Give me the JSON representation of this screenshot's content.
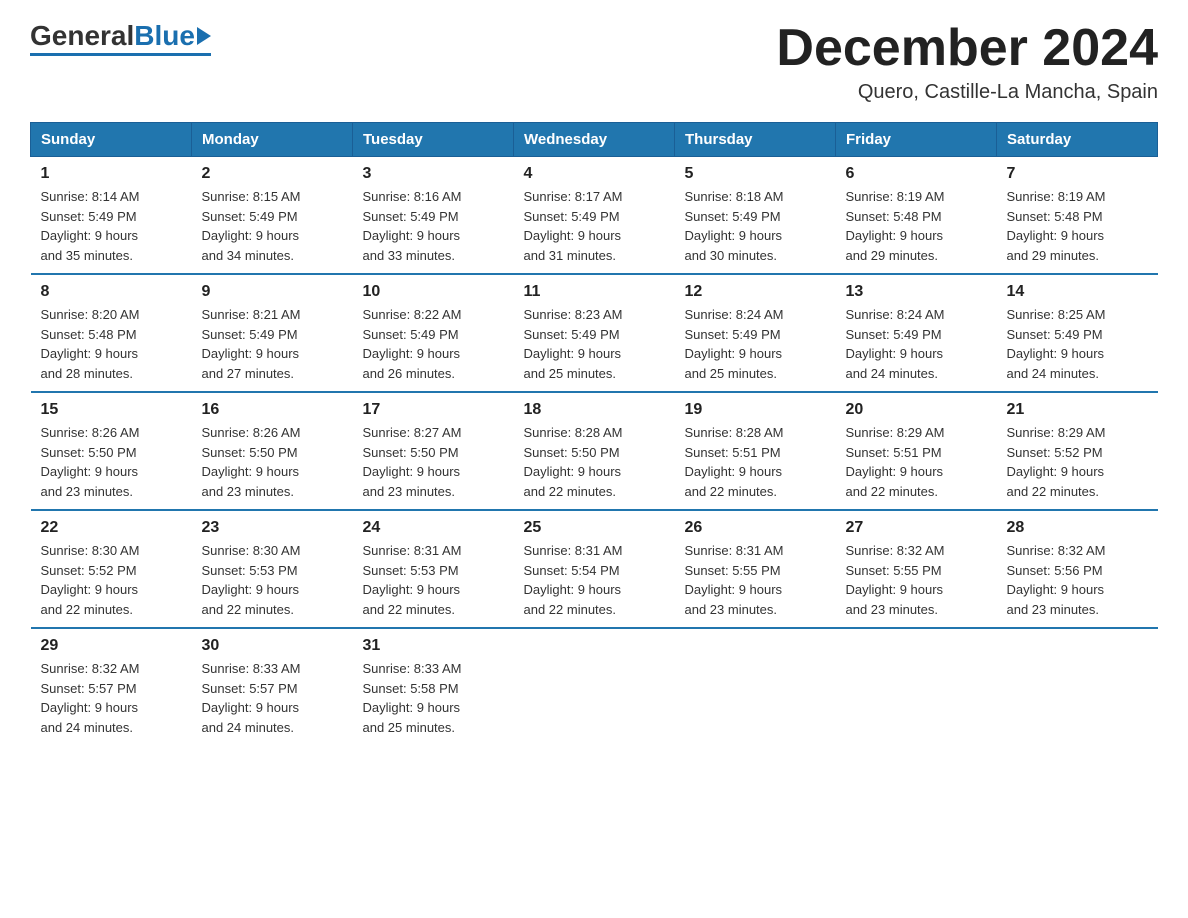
{
  "header": {
    "month_title": "December 2024",
    "location": "Quero, Castille-La Mancha, Spain",
    "logo_general": "General",
    "logo_blue": "Blue"
  },
  "weekdays": [
    "Sunday",
    "Monday",
    "Tuesday",
    "Wednesday",
    "Thursday",
    "Friday",
    "Saturday"
  ],
  "weeks": [
    [
      {
        "day": "1",
        "sunrise": "8:14 AM",
        "sunset": "5:49 PM",
        "daylight": "9 hours and 35 minutes."
      },
      {
        "day": "2",
        "sunrise": "8:15 AM",
        "sunset": "5:49 PM",
        "daylight": "9 hours and 34 minutes."
      },
      {
        "day": "3",
        "sunrise": "8:16 AM",
        "sunset": "5:49 PM",
        "daylight": "9 hours and 33 minutes."
      },
      {
        "day": "4",
        "sunrise": "8:17 AM",
        "sunset": "5:49 PM",
        "daylight": "9 hours and 31 minutes."
      },
      {
        "day": "5",
        "sunrise": "8:18 AM",
        "sunset": "5:49 PM",
        "daylight": "9 hours and 30 minutes."
      },
      {
        "day": "6",
        "sunrise": "8:19 AM",
        "sunset": "5:48 PM",
        "daylight": "9 hours and 29 minutes."
      },
      {
        "day": "7",
        "sunrise": "8:19 AM",
        "sunset": "5:48 PM",
        "daylight": "9 hours and 29 minutes."
      }
    ],
    [
      {
        "day": "8",
        "sunrise": "8:20 AM",
        "sunset": "5:48 PM",
        "daylight": "9 hours and 28 minutes."
      },
      {
        "day": "9",
        "sunrise": "8:21 AM",
        "sunset": "5:49 PM",
        "daylight": "9 hours and 27 minutes."
      },
      {
        "day": "10",
        "sunrise": "8:22 AM",
        "sunset": "5:49 PM",
        "daylight": "9 hours and 26 minutes."
      },
      {
        "day": "11",
        "sunrise": "8:23 AM",
        "sunset": "5:49 PM",
        "daylight": "9 hours and 25 minutes."
      },
      {
        "day": "12",
        "sunrise": "8:24 AM",
        "sunset": "5:49 PM",
        "daylight": "9 hours and 25 minutes."
      },
      {
        "day": "13",
        "sunrise": "8:24 AM",
        "sunset": "5:49 PM",
        "daylight": "9 hours and 24 minutes."
      },
      {
        "day": "14",
        "sunrise": "8:25 AM",
        "sunset": "5:49 PM",
        "daylight": "9 hours and 24 minutes."
      }
    ],
    [
      {
        "day": "15",
        "sunrise": "8:26 AM",
        "sunset": "5:50 PM",
        "daylight": "9 hours and 23 minutes."
      },
      {
        "day": "16",
        "sunrise": "8:26 AM",
        "sunset": "5:50 PM",
        "daylight": "9 hours and 23 minutes."
      },
      {
        "day": "17",
        "sunrise": "8:27 AM",
        "sunset": "5:50 PM",
        "daylight": "9 hours and 23 minutes."
      },
      {
        "day": "18",
        "sunrise": "8:28 AM",
        "sunset": "5:50 PM",
        "daylight": "9 hours and 22 minutes."
      },
      {
        "day": "19",
        "sunrise": "8:28 AM",
        "sunset": "5:51 PM",
        "daylight": "9 hours and 22 minutes."
      },
      {
        "day": "20",
        "sunrise": "8:29 AM",
        "sunset": "5:51 PM",
        "daylight": "9 hours and 22 minutes."
      },
      {
        "day": "21",
        "sunrise": "8:29 AM",
        "sunset": "5:52 PM",
        "daylight": "9 hours and 22 minutes."
      }
    ],
    [
      {
        "day": "22",
        "sunrise": "8:30 AM",
        "sunset": "5:52 PM",
        "daylight": "9 hours and 22 minutes."
      },
      {
        "day": "23",
        "sunrise": "8:30 AM",
        "sunset": "5:53 PM",
        "daylight": "9 hours and 22 minutes."
      },
      {
        "day": "24",
        "sunrise": "8:31 AM",
        "sunset": "5:53 PM",
        "daylight": "9 hours and 22 minutes."
      },
      {
        "day": "25",
        "sunrise": "8:31 AM",
        "sunset": "5:54 PM",
        "daylight": "9 hours and 22 minutes."
      },
      {
        "day": "26",
        "sunrise": "8:31 AM",
        "sunset": "5:55 PM",
        "daylight": "9 hours and 23 minutes."
      },
      {
        "day": "27",
        "sunrise": "8:32 AM",
        "sunset": "5:55 PM",
        "daylight": "9 hours and 23 minutes."
      },
      {
        "day": "28",
        "sunrise": "8:32 AM",
        "sunset": "5:56 PM",
        "daylight": "9 hours and 23 minutes."
      }
    ],
    [
      {
        "day": "29",
        "sunrise": "8:32 AM",
        "sunset": "5:57 PM",
        "daylight": "9 hours and 24 minutes."
      },
      {
        "day": "30",
        "sunrise": "8:33 AM",
        "sunset": "5:57 PM",
        "daylight": "9 hours and 24 minutes."
      },
      {
        "day": "31",
        "sunrise": "8:33 AM",
        "sunset": "5:58 PM",
        "daylight": "9 hours and 25 minutes."
      },
      null,
      null,
      null,
      null
    ]
  ],
  "labels": {
    "sunrise": "Sunrise:",
    "sunset": "Sunset:",
    "daylight": "Daylight:"
  }
}
